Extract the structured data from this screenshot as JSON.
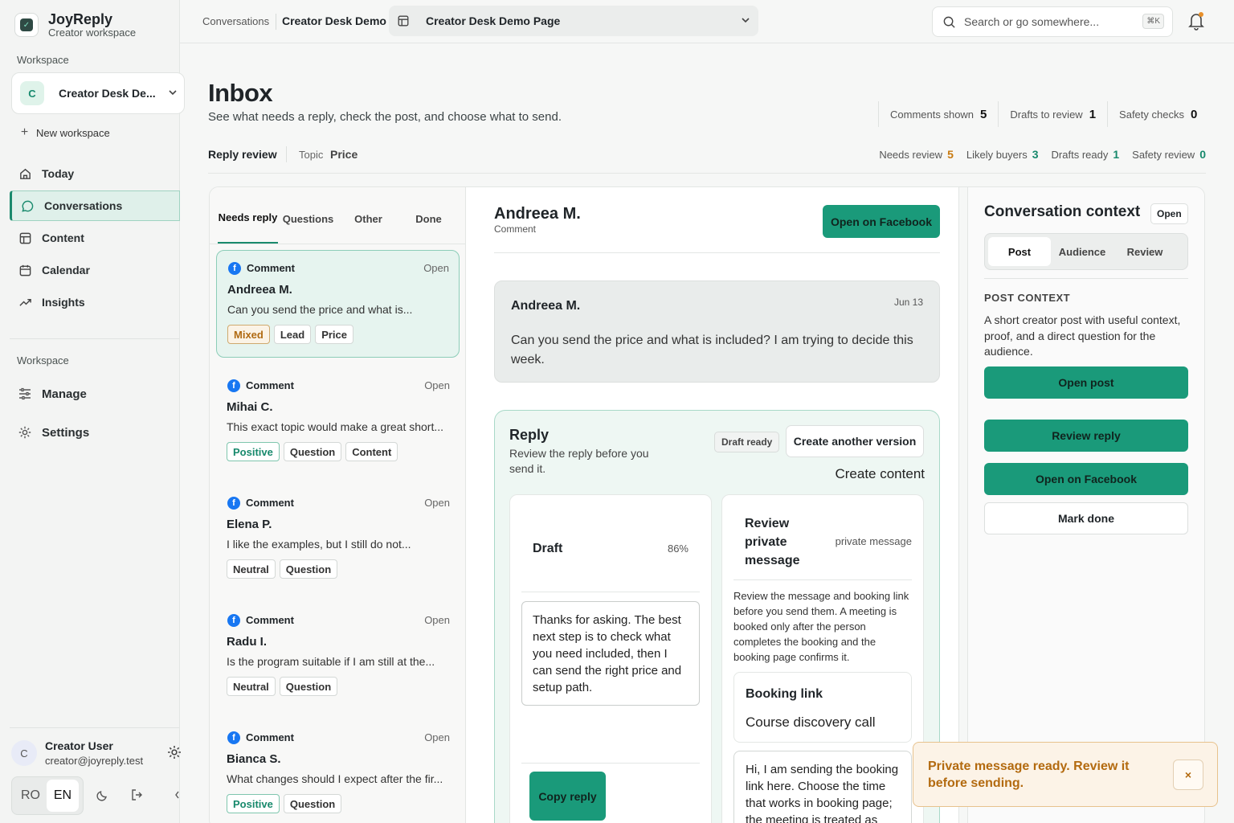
{
  "app": {
    "name": "JoyReply",
    "subtitle": "Creator workspace"
  },
  "sidebar": {
    "workspace_label": "Workspace",
    "workspace": {
      "initial": "C",
      "name": "Creator Desk De..."
    },
    "new_workspace": "New workspace",
    "nav": [
      {
        "label": "Today",
        "icon": "home-icon"
      },
      {
        "label": "Conversations",
        "icon": "chat-icon"
      },
      {
        "label": "Content",
        "icon": "layout-icon"
      },
      {
        "label": "Calendar",
        "icon": "calendar-icon"
      },
      {
        "label": "Insights",
        "icon": "trend-icon"
      }
    ],
    "workspace_label_2": "Workspace",
    "nav2": [
      {
        "label": "Manage",
        "icon": "sliders-icon"
      },
      {
        "label": "Settings",
        "icon": "gear-icon"
      }
    ],
    "user": {
      "initial": "C",
      "name": "Creator User",
      "email": "creator@joyreply.test"
    },
    "languages": [
      "RO",
      "EN"
    ],
    "selected_language": "EN"
  },
  "topbar": {
    "breadcrumb": "Conversations",
    "workspace": "Creator Desk Demo",
    "page_select": "Creator Desk Demo Page",
    "search_placeholder": "Search or go somewhere...",
    "shortcut": "⌘K"
  },
  "header": {
    "title": "Inbox",
    "subtitle": "See what needs a reply, check the post, and choose what to send.",
    "stats": [
      {
        "label": "Comments shown",
        "value": "5"
      },
      {
        "label": "Drafts to review",
        "value": "1"
      },
      {
        "label": "Safety checks",
        "value": "0"
      }
    ],
    "mode": "Reply review",
    "topic_label": "Topic",
    "topic_value": "Price",
    "counts": [
      {
        "label": "Needs review",
        "value": "5",
        "color": "#c87a10"
      },
      {
        "label": "Likely buyers",
        "value": "3",
        "color": "#17896c"
      },
      {
        "label": "Drafts ready",
        "value": "1",
        "color": "#17896c"
      },
      {
        "label": "Safety review",
        "value": "0",
        "color": "#17896c"
      }
    ]
  },
  "list": {
    "tabs": [
      "Needs reply",
      "Questions",
      "Other",
      "Done"
    ],
    "selected_tab": "Needs reply",
    "items": [
      {
        "type": "Comment",
        "status": "Open",
        "name": "Andreea M.",
        "text": "Can you send the price and what is...",
        "tags": [
          "Mixed",
          "Lead",
          "Price"
        ]
      },
      {
        "type": "Comment",
        "status": "Open",
        "name": "Mihai C.",
        "text": "This exact topic would make a great short...",
        "tags": [
          "Positive",
          "Question",
          "Content"
        ]
      },
      {
        "type": "Comment",
        "status": "Open",
        "name": "Elena P.",
        "text": "I like the examples, but I still do not...",
        "tags": [
          "Neutral",
          "Question"
        ]
      },
      {
        "type": "Comment",
        "status": "Open",
        "name": "Radu I.",
        "text": "Is the program suitable if I am still at the...",
        "tags": [
          "Neutral",
          "Question"
        ]
      },
      {
        "type": "Comment",
        "status": "Open",
        "name": "Bianca S.",
        "text": "What changes should I expect after the fir...",
        "tags": [
          "Positive",
          "Question"
        ]
      }
    ]
  },
  "conversation": {
    "name": "Andreea M.",
    "type": "Comment",
    "open_button": "Open on Facebook",
    "message": {
      "author": "Andreea M.",
      "date": "Jun 13",
      "text": "Can you send the price and what is included? I am trying to decide this week."
    },
    "reply": {
      "title": "Reply",
      "subtitle": "Review the reply before you send it.",
      "badge": "Draft ready",
      "another_button": "Create another version",
      "create_content": "Create content",
      "draft": {
        "title": "Draft",
        "confidence": "86%",
        "text": "Thanks for asking. The best next step is to check what you need included, then I can send the right price and setup path.",
        "copy_button": "Copy reply"
      },
      "private": {
        "title": "Review private message",
        "kind": "private message",
        "description": "Review the message and booking link before you send them. A meeting is booked only after the person completes the booking and the booking page confirms it.",
        "booking_title": "Booking link",
        "booking_value": "Course discovery call",
        "message": "Hi, I am sending the booking link here. Choose the time that works in booking page; the meeting is treated as"
      }
    }
  },
  "context": {
    "title": "Conversation context",
    "status": "Open",
    "tabs": [
      "Post",
      "Audience",
      "Review"
    ],
    "selected_tab": "Post",
    "section_label": "POST CONTEXT",
    "description": "A short creator post with useful context, proof, and a direct question for the audience.",
    "buttons": [
      "Open post",
      "Review reply",
      "Open on Facebook"
    ],
    "done_button": "Mark done"
  },
  "toast": {
    "text": "Private message ready. Review it before sending.",
    "close": "×"
  },
  "colors": {
    "accent": "#1a9a7a",
    "accent_light": "#e6f4ef",
    "warning": "#b36a0f",
    "facebook": "#1877f2"
  }
}
